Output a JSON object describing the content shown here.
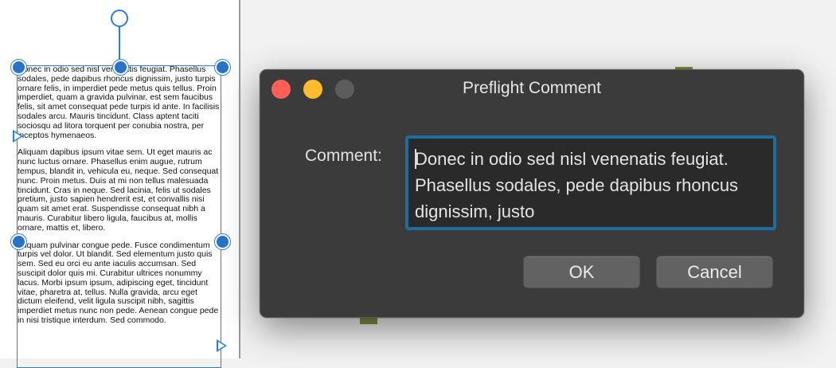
{
  "document": {
    "paragraphs": [
      "Donec in odio sed nisl venenatis feugiat. Phasellus sodales, pede dapibus rhoncus dignissim, justo turpis ornare felis, in imperdiet pede metus quis tellus. Proin imperdiet, quam a gravida pulvinar, est sem faucibus felis, sit amet consequat pede turpis id ante. In facilisis sodales arcu. Mauris tincidunt. Class aptent taciti sociosqu ad litora torquent per conubia nostra, per inceptos hymenaeos.",
      "Aliquam dapibus ipsum vitae sem. Ut eget mauris ac nunc luctus ornare. Phasellus enim augue, rutrum tempus, blandit in, vehicula eu, neque. Sed consequat nunc. Proin metus. Duis at mi non tellus malesuada tincidunt. Cras in neque. Sed lacinia, felis ut sodales pretium, justo sapien hendrerit est, et convallis nisi quam sit amet erat. Suspendisse consequat nibh a mauris. Curabitur libero ligula, faucibus at, mollis ornare, mattis et, libero.",
      "Aliquam pulvinar congue pede. Fusce condimentum turpis vel dolor. Ut blandit. Sed elementum justo quis sem. Sed eu orci eu ante iaculis accumsan. Sed suscipit dolor quis mi. Curabitur ultrices nonummy lacus. Morbi ipsum ipsum, adipiscing eget, tincidunt vitae, pharetra at, tellus. Nulla gravida, arcu eget dictum eleifend, velit ligula suscipit nibh, sagittis imperdiet metus nunc non pede. Aenean congue pede in nisi tristique interdum. Sed commodo."
    ]
  },
  "dialog": {
    "title": "Preflight Comment",
    "comment_label": "Comment:",
    "comment_value": "Donec in odio sed nisl venenatis feugiat. Phasellus sodales, pede dapibus rhoncus dignissim, justo",
    "ok_label": "OK",
    "cancel_label": "Cancel"
  },
  "colors": {
    "selection": "#2f7fd0",
    "dialog_bg": "#3b3b3b",
    "field_focus": "#1f6d9d",
    "close": "#fe5f57",
    "minimize": "#febc2e"
  },
  "icons": [
    "rotation-handle-icon",
    "resize-handle-icon",
    "text-port-icon",
    "close-window-icon",
    "minimize-window-icon",
    "zoom-window-icon"
  ]
}
